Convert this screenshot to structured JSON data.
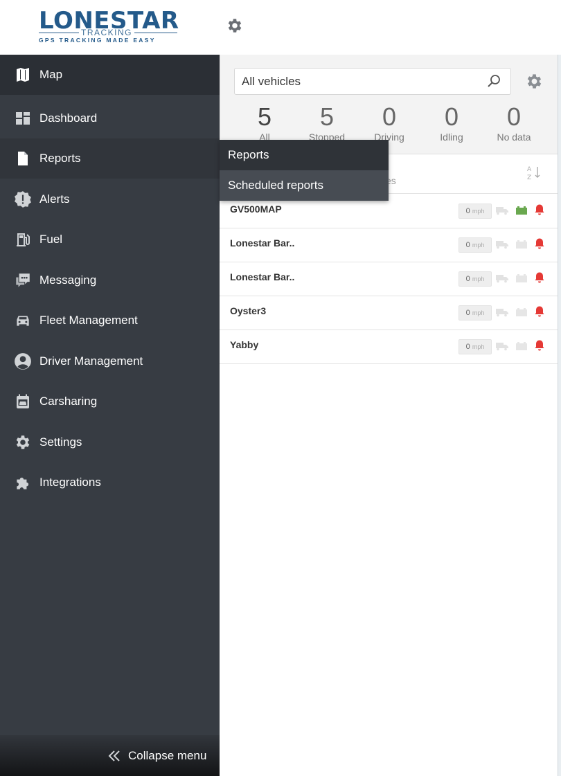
{
  "header": {
    "logo_main": "LONESTAR",
    "logo_track": "TRACKING",
    "logo_sub": "GPS TRACKING MADE EASY",
    "settings_icon": "gear-icon"
  },
  "sidebar": {
    "items": [
      {
        "label": "Map",
        "icon": "map-icon"
      },
      {
        "label": "Dashboard",
        "icon": "dashboard-icon"
      },
      {
        "label": "Reports",
        "icon": "document-icon"
      },
      {
        "label": "Alerts",
        "icon": "alert-icon"
      },
      {
        "label": "Fuel",
        "icon": "fuel-pump-icon"
      },
      {
        "label": "Messaging",
        "icon": "chat-icon"
      },
      {
        "label": "Fleet Management",
        "icon": "car-icon"
      },
      {
        "label": "Driver Management",
        "icon": "user-icon"
      },
      {
        "label": "Carsharing",
        "icon": "calendar-car-icon"
      },
      {
        "label": "Settings",
        "icon": "gear-icon"
      },
      {
        "label": "Integrations",
        "icon": "puzzle-icon"
      }
    ],
    "collapse_label": "Collapse menu"
  },
  "reports_menu": {
    "items": [
      "Reports",
      "Scheduled reports"
    ]
  },
  "panel": {
    "search_value": "All vehicles",
    "stats": [
      {
        "value": "5",
        "label": "All"
      },
      {
        "value": "5",
        "label": "Stopped"
      },
      {
        "value": "0",
        "label": "Driving"
      },
      {
        "value": "0",
        "label": "Idling"
      },
      {
        "value": "0",
        "label": "No data"
      }
    ],
    "list_header_fragment": "es",
    "vehicles": [
      {
        "name": "GV500MAP",
        "speed": "0",
        "unit": "mph",
        "battery_color": "#6aa84f",
        "alert_color": "#e53935"
      },
      {
        "name": "Lonestar Bar..",
        "speed": "0",
        "unit": "mph",
        "battery_color": "#e6e6e6",
        "alert_color": "#e53935"
      },
      {
        "name": "Lonestar Bar..",
        "speed": "0",
        "unit": "mph",
        "battery_color": "#e6e6e6",
        "alert_color": "#e53935"
      },
      {
        "name": "Oyster3",
        "speed": "0",
        "unit": "mph",
        "battery_color": "#e6e6e6",
        "alert_color": "#e53935"
      },
      {
        "name": "Yabby",
        "speed": "0",
        "unit": "mph",
        "battery_color": "#e6e6e6",
        "alert_color": "#e53935"
      }
    ]
  },
  "colors": {
    "sidebar_bg": "#373c43",
    "brand_blue": "#245a8a",
    "alert_red": "#e53935",
    "battery_green": "#6aa84f"
  }
}
